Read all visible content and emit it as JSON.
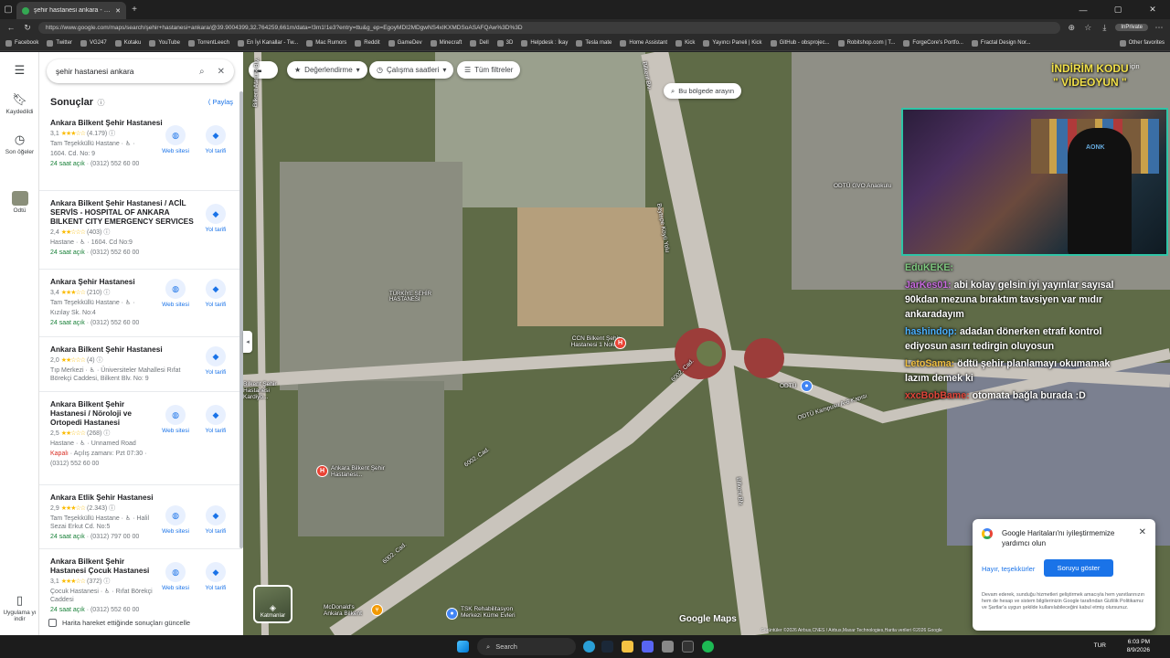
{
  "browser": {
    "tab_title": "şehir hastanesi ankara - Google Ha",
    "url": "https://www.google.com/maps/search/şehir+hastanesi+ankara/@39.9004399,32.764259,661m/data=!3m1!1e3?entry=ttu&g_ep=EgoyMDI2MDgwNS4xIKXMDSoASAFQAw%3D%3D",
    "private_label": "InPrivate",
    "bookmarks": [
      "Facebook",
      "Twitter",
      "VG247",
      "Kotaku",
      "YouTube",
      "TorrentLeech",
      "En İyi Kanallar - Tw...",
      "Mac Rumors",
      "Reddit",
      "GameDev",
      "Minecraft",
      "Dell",
      "3D",
      "Helpdesk : İkay",
      "Tesla mate",
      "Home Assistant",
      "Kick",
      "Yayıncı Paneli | Kick",
      "GitHub - obsprojec...",
      "Robitshop.com | T...",
      "ForgeCore's Portfo...",
      "Fractal Design Nor..."
    ],
    "other_favorites": "Other favorites"
  },
  "rail": {
    "saved": "Kaydedildi",
    "recent": "Son öğeler",
    "odtu": "Odtü",
    "app": "Uygulama yı indir"
  },
  "search": {
    "query": "şehir hastanesi ankara"
  },
  "results": {
    "title": "Sonuçlar",
    "share": "Paylaş",
    "website_label": "Web sitesi",
    "directions_label": "Yol tarifi",
    "items": [
      {
        "name": "Ankara Bilkent Şehir Hastanesi",
        "rating": "3,1",
        "stars": "★★★☆☆",
        "reviews": "(4.179)",
        "line1": "Tam Teşekküllü Hastane · ♿ ·",
        "line2": "1604. Cd. No: 9",
        "status": "24 saat açık",
        "phone": " · (0312) 552 60 00",
        "website": true
      },
      {
        "name": "Ankara Bilkent Şehir Hastanesi / ACİL SERVİS - HOSPITAL OF ANKARA BILKENT CITY EMERGENCY SERVICES",
        "rating": "2,4",
        "stars": "★★☆☆☆",
        "reviews": "(403)",
        "line1": "Hastane · ♿ · 1604. Cd No:9",
        "line2": "",
        "status": "24 saat açık",
        "phone": " · (0312) 552 60 00",
        "website": false
      },
      {
        "name": "Ankara Şehir Hastanesi",
        "rating": "3,4",
        "stars": "★★★☆☆",
        "reviews": "(210)",
        "line1": "Tam Teşekküllü Hastane · ♿ ·",
        "line2": "Kızılay Sk. No:4",
        "status": "24 saat açık",
        "phone": " · (0312) 552 60 00",
        "website": true
      },
      {
        "name": "Ankara Bilkent Şehir Hastanesi",
        "rating": "2,0",
        "stars": "★★☆☆☆",
        "reviews": "(4)",
        "line1": "Tıp Merkezi · ♿ · Üniversiteler Mahallesi Rıfat Börekçi Caddesi, Bilkent Blv. No: 9",
        "line2": "",
        "status": "",
        "phone": "",
        "website": false
      },
      {
        "name": "Ankara Bilkent Şehir Hastanesi / Nöroloji ve Ortopedi Hastanesi",
        "rating": "2,5",
        "stars": "★★☆☆☆",
        "reviews": "(268)",
        "line1": "Hastane · ♿ · Unnamed Road",
        "line2": "",
        "status_closed": "Kapalı",
        "status_extra": " · Açılış zamanı: Pzt 07:30 ·",
        "phone": "(0312) 552 60 00",
        "website": true
      },
      {
        "name": "Ankara Etlik Şehir Hastanesi",
        "rating": "2,9",
        "stars": "★★★☆☆",
        "reviews": "(2.343)",
        "line1": "Tam Teşekküllü Hastane · ♿ · Halil Sezai Erkut Cd. No:5",
        "line2": "",
        "status": "24 saat açık",
        "phone": " · (0312) 797 00 00",
        "website": true
      },
      {
        "name": "Ankara Bilkent Şehir Hastanesi Çocuk Hastanesi",
        "rating": "3,1",
        "stars": "★★★☆☆",
        "reviews": "(372)",
        "line1": "Çocuk Hastanesi · ♿ · Rıfat Börekçi Caddesi",
        "line2": "",
        "status": "24 saat açık",
        "phone": " · (0312) 552 60 00",
        "website": true
      }
    ],
    "move_checkbox": "Harita hareket ettiğinde sonuçları güncelle"
  },
  "map": {
    "chip_ratings": "Değerlendirme",
    "chip_hours": "Çalışma saatleri",
    "chip_filters": "Tüm filtreler",
    "search_area": "Bu bölgede arayın",
    "layers": "Katmanlar",
    "logo": "Google Maps",
    "attribution": "Görüntüler ©2026 Airbus,CNES / Airbus,Maxar Technologies,Harita verileri ©2026 Google",
    "labels": {
      "bilkent_ataturk": "Bilkent Atatürk Blv.",
      "bilkent_blv_top": "Bilkent Blv.",
      "beytepe": "Beytepe Köyü Yolu",
      "odtu_gvo": "ODTÜ GVO Anaokulu",
      "ccn": "CCN Bilkent Şehir Hastanesi 1 Nolu...",
      "cad6002_a": "6002. Cad.",
      "cad6002_b": "6002. Cad.",
      "cad6002_c": "6002. Cad.",
      "odtu_kampusu": "ODTÜ Kampusu A-8 Kapısı",
      "odtu": "ODTÜ",
      "bilkent_blv_bottom": "Bilkent Blv.",
      "bilkent_sehir_pin": "Ankara Bilkent Şehir Hastanesi...",
      "tsk": "TSK Rehabilitasyon Merkezi Küme Evleri",
      "mcdonalds": "McDonald's Ankara Bilkent",
      "hastanesi_left": "Bilkent Şehir Hastanesi Kardiyo...",
      "center_building": "TÜRKİYE ŞEHİR HASTANESİ"
    }
  },
  "stream": {
    "promo_line1": "İNDİRİM KODU",
    "promo_line2": "\" VİDEOYUN \"",
    "promo_suffix": "için",
    "webcam_brand": "AONK",
    "chat": [
      {
        "nick": "EduKEKE:",
        "text": "",
        "color": "#7fc97f"
      },
      {
        "nick": "JarKes01:",
        "text": " abi kolay gelsin iyi yayınlar sayısal 90kdan mezuna bıraktım tavsiyen var mıdır ankaradayım",
        "color": "#c86adf"
      },
      {
        "nick": "hashindop:",
        "text": " adadan dönerken etrafı kontrol ediyosun asırı tedirgin oluyosun",
        "color": "#4ab0ff"
      },
      {
        "nick": "LetoSama:",
        "text": " ödtü şehir planlamayı okumamak lazım demek ki",
        "color": "#f0c040"
      },
      {
        "nick": "xxcBobBame:",
        "text": " otomata bağla burada :D",
        "color": "#e0453a"
      }
    ]
  },
  "survey": {
    "title": "Google Haritaları'nı iyileştirmemize yardımcı olun",
    "no": "Hayır, teşekkürler",
    "yes": "Soruyu göster",
    "legal": "Devam ederek, sunduğu hizmetleri geliştirmek amacıyla hem yanıtlarınızın hem de hesap ve sistem bilgilerinizin Google tarafından Gizlilik Politikamız ve Şartlar'a uygun şekilde kullanılabileceğini kabul etmiş olursunuz."
  },
  "taskbar": {
    "search": "Search",
    "lang": "TUR",
    "time": "6:03 PM",
    "date": "8/9/2026"
  },
  "colors": {
    "accent": "#1a73e8",
    "open": "#188038",
    "closed": "#d93025",
    "star": "#fbbc04"
  }
}
